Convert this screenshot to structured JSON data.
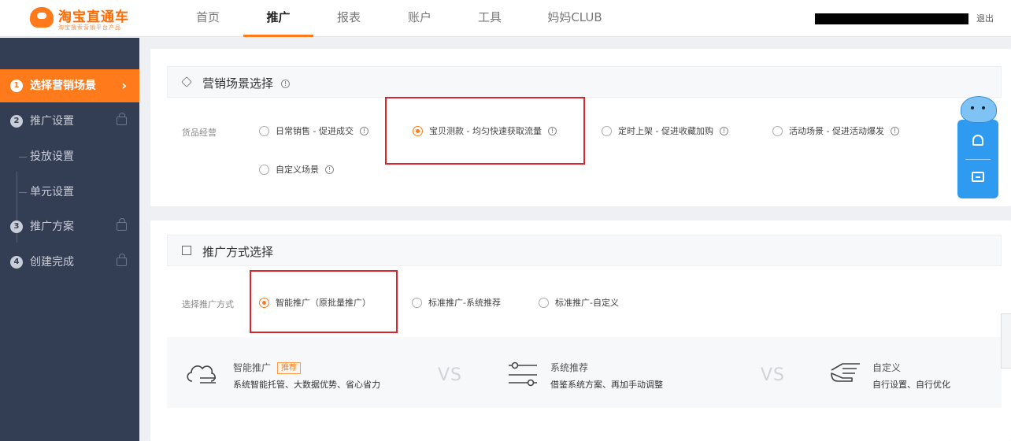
{
  "header": {
    "logo_title": "淘宝直通车",
    "logo_subtitle": "淘宝搜索营销平台产品",
    "nav": [
      {
        "label": "首页",
        "active": false
      },
      {
        "label": "推广",
        "active": true
      },
      {
        "label": "报表",
        "active": false
      },
      {
        "label": "账户",
        "active": false
      },
      {
        "label": "工具",
        "active": false
      },
      {
        "label": "妈妈CLUB",
        "active": false
      }
    ],
    "logout": "退出"
  },
  "sidebar": {
    "steps": [
      {
        "num": "1",
        "label": "选择营销场景",
        "active": true,
        "arrow": "›"
      },
      {
        "num": "2",
        "label": "推广设置",
        "active": false
      },
      {
        "num": "3",
        "label": "推广方案",
        "active": false
      },
      {
        "num": "4",
        "label": "创建完成",
        "active": false
      }
    ],
    "sub_steps": [
      "投放设置",
      "单元设置"
    ]
  },
  "scene": {
    "title": "营销场景选择",
    "row_label": "货品经营",
    "options": [
      {
        "label": "日常销售 - 促进成交",
        "checked": false
      },
      {
        "label": "宝贝测款 - 均匀快速获取流量",
        "checked": true
      },
      {
        "label": "定时上架 - 促进收藏加购",
        "checked": false
      },
      {
        "label": "活动场景 - 促进活动爆发",
        "checked": false
      },
      {
        "label": "自定义场景",
        "checked": false
      }
    ]
  },
  "method": {
    "title": "推广方式选择",
    "row_label": "选择推广方式",
    "options": [
      {
        "label": "智能推广（原批量推广）",
        "checked": true
      },
      {
        "label": "标准推广-系统推荐",
        "checked": false
      },
      {
        "label": "标准推广-自定义",
        "checked": false
      }
    ],
    "compare": [
      {
        "title": "智能推广",
        "tag": "推荐",
        "desc": "系统智能托管、大数据优势、省心省力"
      },
      {
        "title": "系统推荐",
        "desc": "借鉴系统方案、再加手动调整"
      },
      {
        "title": "自定义",
        "desc": "自行设置、自行优化"
      }
    ],
    "vs": "VS"
  },
  "info_glyph": "!",
  "colors": {
    "accent": "#ff7a1a",
    "sidebar": "#333d54",
    "highlight": "#d9262c",
    "widget": "#2e9bf0"
  }
}
